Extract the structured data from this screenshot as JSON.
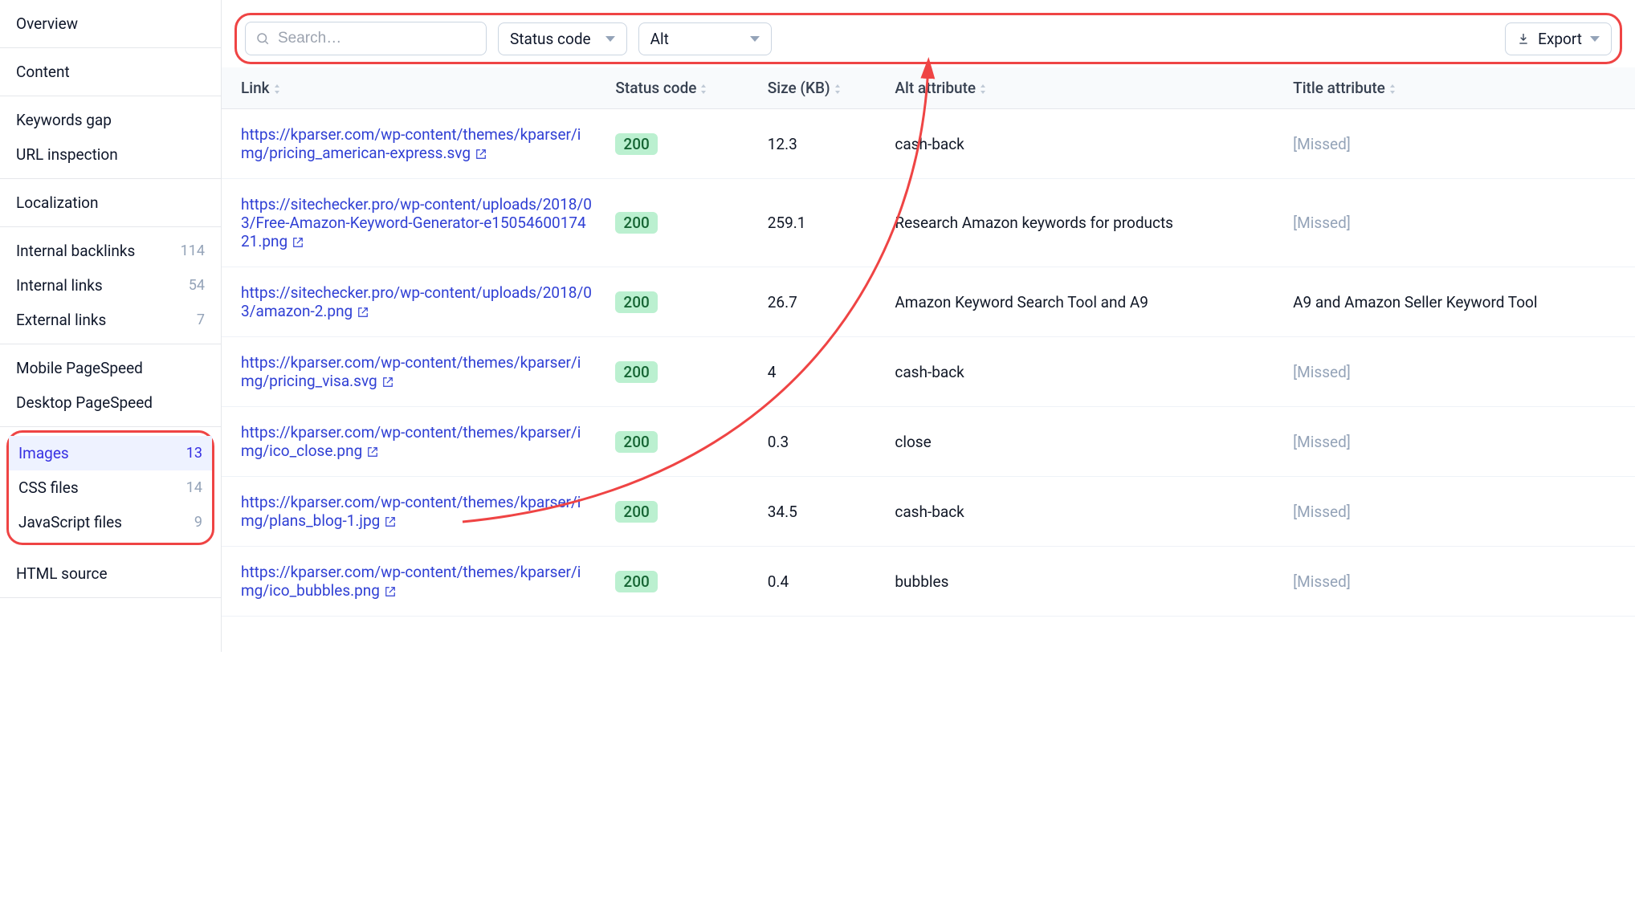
{
  "sidebar": {
    "sections": [
      {
        "items": [
          {
            "label": "Overview"
          }
        ]
      },
      {
        "items": [
          {
            "label": "Content"
          }
        ]
      },
      {
        "items": [
          {
            "label": "Keywords gap"
          },
          {
            "label": "URL inspection"
          }
        ]
      },
      {
        "items": [
          {
            "label": "Localization"
          }
        ]
      },
      {
        "items": [
          {
            "label": "Internal backlinks",
            "count": "114"
          },
          {
            "label": "Internal links",
            "count": "54"
          },
          {
            "label": "External links",
            "count": "7"
          }
        ]
      },
      {
        "items": [
          {
            "label": "Mobile PageSpeed"
          },
          {
            "label": "Desktop PageSpeed"
          }
        ]
      },
      {
        "highlight": true,
        "items": [
          {
            "label": "Images",
            "count": "13",
            "active": true
          },
          {
            "label": "CSS files",
            "count": "14"
          },
          {
            "label": "JavaScript files",
            "count": "9"
          }
        ]
      },
      {
        "items": [
          {
            "label": "HTML source"
          }
        ]
      }
    ]
  },
  "toolbar": {
    "search_placeholder": "Search…",
    "status_label": "Status code",
    "alt_label": "Alt",
    "export_label": "Export"
  },
  "table": {
    "headers": {
      "link": "Link",
      "status": "Status code",
      "size": "Size (KB)",
      "alt": "Alt attribute",
      "title": "Title attribute"
    },
    "rows": [
      {
        "link": "https://kparser.com/wp-content/themes/kparser/img/pricing_american-express.svg",
        "status": "200",
        "size": "12.3",
        "alt": "cash-back",
        "title": "[Missed]"
      },
      {
        "link": "https://sitechecker.pro/wp-content/uploads/2018/03/Free-Amazon-Keyword-Generator-e1505460017421.png",
        "status": "200",
        "size": "259.1",
        "alt": "Research Amazon keywords for products",
        "title": "[Missed]"
      },
      {
        "link": "https://sitechecker.pro/wp-content/uploads/2018/03/amazon-2.png",
        "status": "200",
        "size": "26.7",
        "alt": "Amazon Keyword Search Tool and A9",
        "title": "A9 and Amazon Seller Keyword Tool"
      },
      {
        "link": "https://kparser.com/wp-content/themes/kparser/img/pricing_visa.svg",
        "status": "200",
        "size": "4",
        "alt": "cash-back",
        "title": "[Missed]"
      },
      {
        "link": "https://kparser.com/wp-content/themes/kparser/img/ico_close.png",
        "status": "200",
        "size": "0.3",
        "alt": "close",
        "title": "[Missed]"
      },
      {
        "link": "https://kparser.com/wp-content/themes/kparser/img/plans_blog-1.jpg",
        "status": "200",
        "size": "34.5",
        "alt": "cash-back",
        "title": "[Missed]"
      },
      {
        "link": "https://kparser.com/wp-content/themes/kparser/img/ico_bubbles.png",
        "status": "200",
        "size": "0.4",
        "alt": "bubbles",
        "title": "[Missed]"
      }
    ]
  }
}
